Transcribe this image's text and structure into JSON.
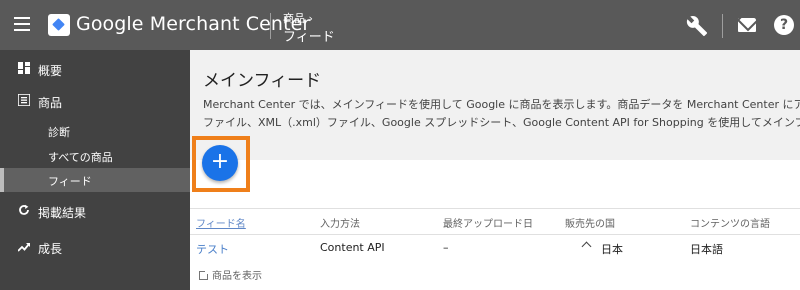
{
  "header": {
    "brand": "Google Merchant Center",
    "breadcrumb_parent": "商品 ›",
    "breadcrumb_current": "フィード"
  },
  "icons": [
    "menu-icon",
    "merchant-center-logo-icon",
    "wrench-icon",
    "mail-icon",
    "help-icon",
    "dashboard-icon",
    "list-icon",
    "sync-icon",
    "trending-up-icon",
    "external-link-icon",
    "chevron-up-icon"
  ],
  "sidebar": {
    "items": [
      {
        "label": "概要"
      },
      {
        "label": "商品"
      },
      {
        "label": "診断"
      },
      {
        "label": "すべての商品"
      },
      {
        "label": "フィード"
      },
      {
        "label": "掲載結果"
      },
      {
        "label": "成長"
      }
    ]
  },
  "main": {
    "title": "メインフィード",
    "desc_line1": "Merchant Center では、メインフィードを使用して Google に商品を表示します。商品データを Merchant Center にアッ",
    "desc_line2": "ファイル、XML（.xml）ファイル、Google スプレッドシート、Google Content API for Shopping を使用してメインフィ",
    "add_button": "+",
    "table": {
      "headers": [
        "フィード名",
        "入力方法",
        "最終アップロード日",
        "販売先の国",
        "コンテンツの言語"
      ],
      "rows": [
        {
          "name": "テスト",
          "method": "Content API",
          "last_upload": "–",
          "country": "日本",
          "language": "日本語"
        }
      ]
    },
    "view_products": "商品を表示"
  },
  "colors": {
    "topbar": "#595959",
    "sidebar": "#424242",
    "accent": "#1a73e8",
    "highlight": "#ef7f1a",
    "link": "#4a7fc9"
  }
}
